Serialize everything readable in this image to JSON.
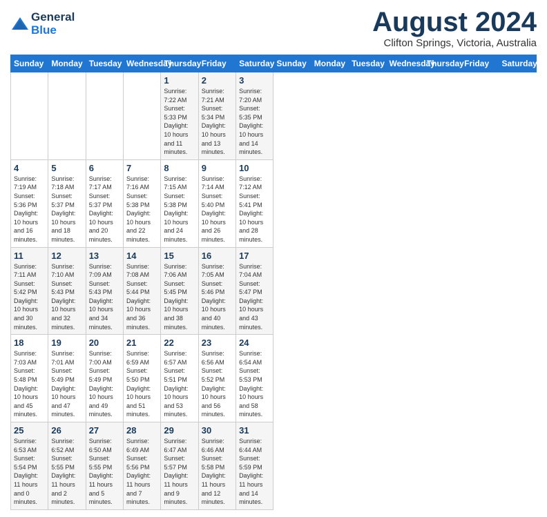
{
  "header": {
    "logo_line1": "General",
    "logo_line2": "Blue",
    "month_year": "August 2024",
    "location": "Clifton Springs, Victoria, Australia"
  },
  "weekdays": [
    "Sunday",
    "Monday",
    "Tuesday",
    "Wednesday",
    "Thursday",
    "Friday",
    "Saturday"
  ],
  "weeks": [
    [
      {
        "day": "",
        "info": ""
      },
      {
        "day": "",
        "info": ""
      },
      {
        "day": "",
        "info": ""
      },
      {
        "day": "",
        "info": ""
      },
      {
        "day": "1",
        "info": "Sunrise: 7:22 AM\nSunset: 5:33 PM\nDaylight: 10 hours\nand 11 minutes."
      },
      {
        "day": "2",
        "info": "Sunrise: 7:21 AM\nSunset: 5:34 PM\nDaylight: 10 hours\nand 13 minutes."
      },
      {
        "day": "3",
        "info": "Sunrise: 7:20 AM\nSunset: 5:35 PM\nDaylight: 10 hours\nand 14 minutes."
      }
    ],
    [
      {
        "day": "4",
        "info": "Sunrise: 7:19 AM\nSunset: 5:36 PM\nDaylight: 10 hours\nand 16 minutes."
      },
      {
        "day": "5",
        "info": "Sunrise: 7:18 AM\nSunset: 5:37 PM\nDaylight: 10 hours\nand 18 minutes."
      },
      {
        "day": "6",
        "info": "Sunrise: 7:17 AM\nSunset: 5:37 PM\nDaylight: 10 hours\nand 20 minutes."
      },
      {
        "day": "7",
        "info": "Sunrise: 7:16 AM\nSunset: 5:38 PM\nDaylight: 10 hours\nand 22 minutes."
      },
      {
        "day": "8",
        "info": "Sunrise: 7:15 AM\nSunset: 5:38 PM\nDaylight: 10 hours\nand 24 minutes."
      },
      {
        "day": "9",
        "info": "Sunrise: 7:14 AM\nSunset: 5:40 PM\nDaylight: 10 hours\nand 26 minutes."
      },
      {
        "day": "10",
        "info": "Sunrise: 7:12 AM\nSunset: 5:41 PM\nDaylight: 10 hours\nand 28 minutes."
      }
    ],
    [
      {
        "day": "11",
        "info": "Sunrise: 7:11 AM\nSunset: 5:42 PM\nDaylight: 10 hours\nand 30 minutes."
      },
      {
        "day": "12",
        "info": "Sunrise: 7:10 AM\nSunset: 5:43 PM\nDaylight: 10 hours\nand 32 minutes."
      },
      {
        "day": "13",
        "info": "Sunrise: 7:09 AM\nSunset: 5:43 PM\nDaylight: 10 hours\nand 34 minutes."
      },
      {
        "day": "14",
        "info": "Sunrise: 7:08 AM\nSunset: 5:44 PM\nDaylight: 10 hours\nand 36 minutes."
      },
      {
        "day": "15",
        "info": "Sunrise: 7:06 AM\nSunset: 5:45 PM\nDaylight: 10 hours\nand 38 minutes."
      },
      {
        "day": "16",
        "info": "Sunrise: 7:05 AM\nSunset: 5:46 PM\nDaylight: 10 hours\nand 40 minutes."
      },
      {
        "day": "17",
        "info": "Sunrise: 7:04 AM\nSunset: 5:47 PM\nDaylight: 10 hours\nand 43 minutes."
      }
    ],
    [
      {
        "day": "18",
        "info": "Sunrise: 7:03 AM\nSunset: 5:48 PM\nDaylight: 10 hours\nand 45 minutes."
      },
      {
        "day": "19",
        "info": "Sunrise: 7:01 AM\nSunset: 5:49 PM\nDaylight: 10 hours\nand 47 minutes."
      },
      {
        "day": "20",
        "info": "Sunrise: 7:00 AM\nSunset: 5:49 PM\nDaylight: 10 hours\nand 49 minutes."
      },
      {
        "day": "21",
        "info": "Sunrise: 6:59 AM\nSunset: 5:50 PM\nDaylight: 10 hours\nand 51 minutes."
      },
      {
        "day": "22",
        "info": "Sunrise: 6:57 AM\nSunset: 5:51 PM\nDaylight: 10 hours\nand 53 minutes."
      },
      {
        "day": "23",
        "info": "Sunrise: 6:56 AM\nSunset: 5:52 PM\nDaylight: 10 hours\nand 56 minutes."
      },
      {
        "day": "24",
        "info": "Sunrise: 6:54 AM\nSunset: 5:53 PM\nDaylight: 10 hours\nand 58 minutes."
      }
    ],
    [
      {
        "day": "25",
        "info": "Sunrise: 6:53 AM\nSunset: 5:54 PM\nDaylight: 11 hours\nand 0 minutes."
      },
      {
        "day": "26",
        "info": "Sunrise: 6:52 AM\nSunset: 5:55 PM\nDaylight: 11 hours\nand 2 minutes."
      },
      {
        "day": "27",
        "info": "Sunrise: 6:50 AM\nSunset: 5:55 PM\nDaylight: 11 hours\nand 5 minutes."
      },
      {
        "day": "28",
        "info": "Sunrise: 6:49 AM\nSunset: 5:56 PM\nDaylight: 11 hours\nand 7 minutes."
      },
      {
        "day": "29",
        "info": "Sunrise: 6:47 AM\nSunset: 5:57 PM\nDaylight: 11 hours\nand 9 minutes."
      },
      {
        "day": "30",
        "info": "Sunrise: 6:46 AM\nSunset: 5:58 PM\nDaylight: 11 hours\nand 12 minutes."
      },
      {
        "day": "31",
        "info": "Sunrise: 6:44 AM\nSunset: 5:59 PM\nDaylight: 11 hours\nand 14 minutes."
      }
    ]
  ]
}
